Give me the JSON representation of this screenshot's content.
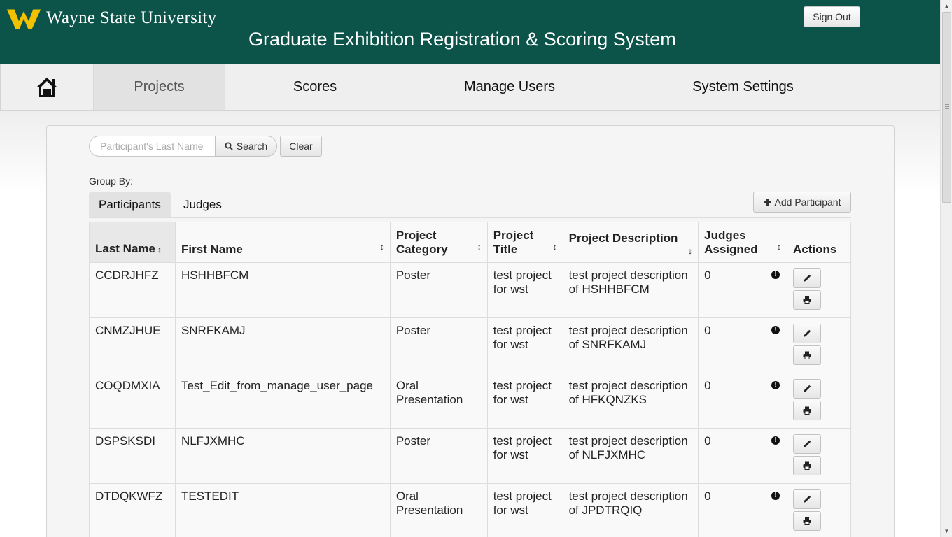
{
  "header": {
    "university": "Wayne State University",
    "app_title": "Graduate Exhibition Registration & Scoring System",
    "signout_label": "Sign Out",
    "brand_color": "#0c5449",
    "logo_color": "#f2c200"
  },
  "nav": {
    "home_icon": "home-icon",
    "items": [
      {
        "label": "Projects",
        "active": true
      },
      {
        "label": "Scores",
        "active": false
      },
      {
        "label": "Manage Users",
        "active": false
      },
      {
        "label": "System Settings",
        "active": false
      }
    ]
  },
  "search": {
    "placeholder": "Participant's Last Name",
    "value": "",
    "button_label": "Search",
    "clear_label": "Clear"
  },
  "group_by": {
    "label": "Group By:",
    "tabs": [
      {
        "label": "Participants",
        "active": true
      },
      {
        "label": "Judges",
        "active": false
      }
    ]
  },
  "add_participant_label": "Add Participant",
  "table": {
    "columns": [
      {
        "label": "Last Name",
        "sorted": true
      },
      {
        "label": "First Name"
      },
      {
        "label": "Project Category"
      },
      {
        "label": "Project Title"
      },
      {
        "label": "Project Description"
      },
      {
        "label": "Judges Assigned"
      },
      {
        "label": "Actions"
      }
    ],
    "rows": [
      {
        "last": "CCDRJHFZ",
        "first": "HSHHBFCM",
        "category": "Poster",
        "title": "test project for wst",
        "description": "test project description of HSHHBFCM",
        "judges": "0"
      },
      {
        "last": "CNMZJHUE",
        "first": "SNRFKAMJ",
        "category": "Poster",
        "title": "test project for wst",
        "description": "test project description of SNRFKAMJ",
        "judges": "0"
      },
      {
        "last": "COQDMXIA",
        "first": "Test_Edit_from_manage_user_page",
        "category": "Oral Presentation",
        "title": "test project for wst",
        "description": "test project description of HFKQNZKS",
        "judges": "0"
      },
      {
        "last": "DSPSKSDI",
        "first": "NLFJXMHC",
        "category": "Poster",
        "title": "test project for wst",
        "description": "test project description of NLFJXMHC",
        "judges": "0"
      },
      {
        "last": "DTDQKWFZ",
        "first": "TESTEDIT",
        "category": "Oral Presentation",
        "title": "test project for wst",
        "description": "test project description of JPDTRQIQ",
        "judges": "0"
      }
    ]
  }
}
